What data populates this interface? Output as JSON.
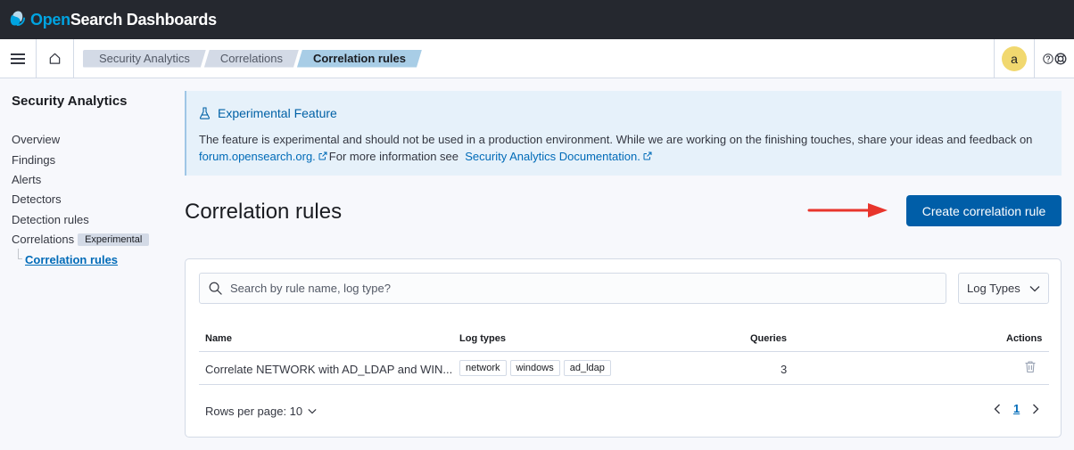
{
  "header": {
    "logo_open": "Open",
    "logo_rest": "Search Dashboards"
  },
  "breadcrumbs": [
    "Security Analytics",
    "Correlations",
    "Correlation rules"
  ],
  "user": {
    "avatar_letter": "a"
  },
  "sidebar": {
    "title": "Security Analytics",
    "items": [
      "Overview",
      "Findings",
      "Alerts",
      "Detectors",
      "Detection rules",
      "Correlations"
    ],
    "correlations_badge": "Experimental",
    "sub_item": "Correlation rules"
  },
  "callout": {
    "title": "Experimental Feature",
    "text_1": "The feature is experimental and should not be used in a production environment. While we are working on the finishing touches, share your ideas and feedback on",
    "link_1": "forum.opensearch.org.",
    "text_2": "For more information see",
    "link_2": "Security Analytics Documentation."
  },
  "page": {
    "title": "Correlation rules",
    "create_button": "Create correlation rule"
  },
  "table": {
    "search_placeholder": "Search by rule name, log type?",
    "filter_label": "Log Types",
    "columns": {
      "name": "Name",
      "log_types": "Log types",
      "queries": "Queries",
      "actions": "Actions"
    },
    "rows": [
      {
        "name": "Correlate NETWORK with AD_LDAP and WIN...",
        "log_types": [
          "network",
          "windows",
          "ad_ldap"
        ],
        "queries": "3"
      }
    ],
    "rows_per_page": "Rows per page: 10",
    "current_page": "1"
  },
  "colors": {
    "header_bg": "#25282f",
    "primary": "#005ea8",
    "link": "#006bb8",
    "callout_bg": "#e6f1fa",
    "avatar_bg": "#f1d86f",
    "arrow": "#e8352c"
  }
}
